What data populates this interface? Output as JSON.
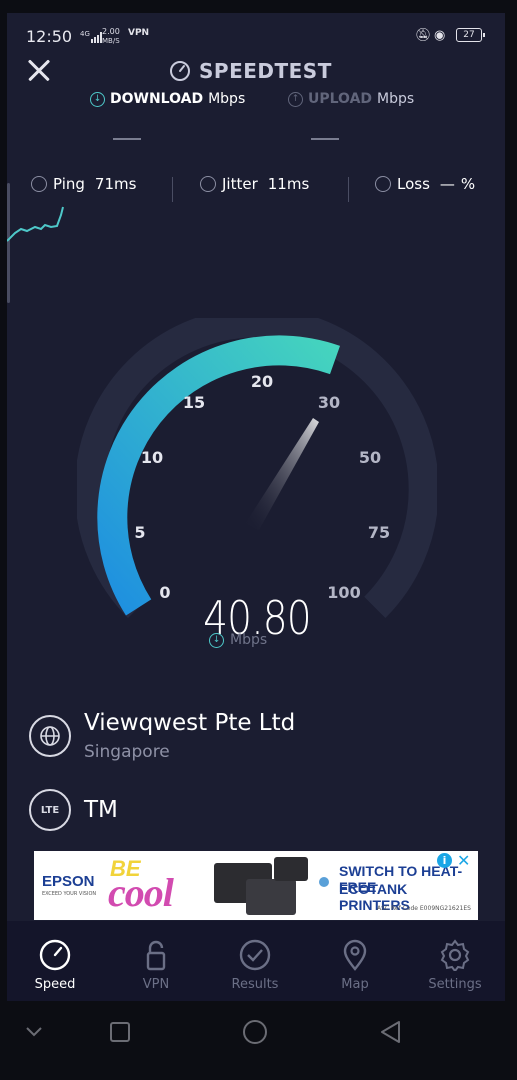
{
  "status_bar": {
    "time": "12:50",
    "net_type": "4G",
    "data_speed_value": "2.00",
    "data_speed_unit": "MB/S",
    "vpn_badge": "VPN",
    "battery": "27"
  },
  "header": {
    "title": "SPEEDTEST",
    "tabs": [
      {
        "label": "DOWNLOAD",
        "unit": "Mbps",
        "value": "—"
      },
      {
        "label": "UPLOAD",
        "unit": "Mbps",
        "value": "—"
      }
    ]
  },
  "metrics": {
    "ping": {
      "label": "Ping",
      "value": "71ms"
    },
    "jitter": {
      "label": "Jitter",
      "value": "11ms"
    },
    "loss": {
      "label": "Loss",
      "value": "—",
      "unit": "%"
    }
  },
  "gauge": {
    "labels": [
      "0",
      "5",
      "10",
      "15",
      "20",
      "30",
      "50",
      "75",
      "100"
    ],
    "value": "40.80",
    "unit": "Mbps",
    "colors": {
      "fill_start": "#1e8fe0",
      "fill_end": "#45d4be",
      "track": "#262a40"
    }
  },
  "server": {
    "name": "Viewqwest Pte Ltd",
    "location": "Singapore"
  },
  "carrier": {
    "badge": "LTE",
    "name": "TM"
  },
  "ad": {
    "brand": "EPSON",
    "brand_tagline": "EXCEED YOUR VISION",
    "be": "BE",
    "cool": "cool",
    "headline_1": "SWITCH TO HEAT-FREE",
    "headline_2": "ECOTANK PRINTERS",
    "ref": "ASC Ref Code E009NG21621ES",
    "info": "i",
    "close": "✕"
  },
  "bottom_nav": [
    {
      "label": "Speed",
      "icon": "speedometer-icon",
      "active": true
    },
    {
      "label": "VPN",
      "icon": "lock-icon",
      "active": false
    },
    {
      "label": "Results",
      "icon": "check-circle-icon",
      "active": false
    },
    {
      "label": "Map",
      "icon": "map-pin-icon",
      "active": false
    },
    {
      "label": "Settings",
      "icon": "gear-icon",
      "active": false
    }
  ]
}
